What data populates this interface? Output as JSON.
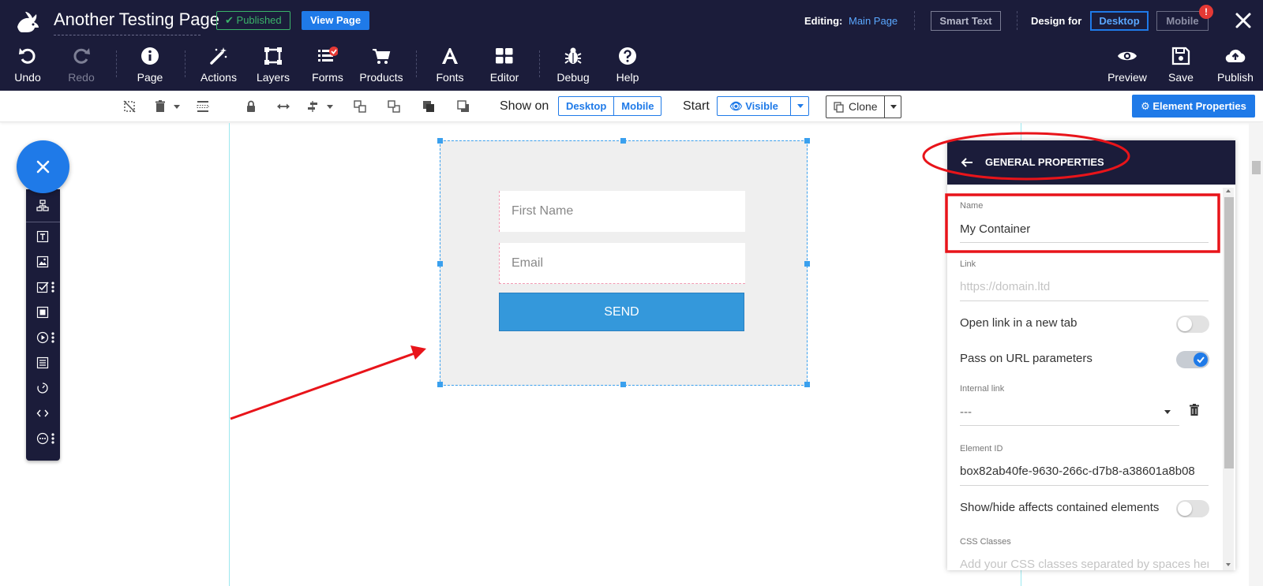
{
  "header": {
    "page_title": "Another Testing Page",
    "published_label": "Published",
    "view_page_label": "View Page",
    "editing_label": "Editing:",
    "editing_value": "Main Page",
    "smart_text_label": "Smart Text",
    "design_for_label": "Design for",
    "design_desktop": "Desktop",
    "design_mobile": "Mobile",
    "alert_count": "!"
  },
  "toolbar": [
    {
      "label": "Undo",
      "icon": "undo-icon"
    },
    {
      "label": "Redo",
      "icon": "redo-icon",
      "disabled": true
    },
    {
      "label": "Page",
      "icon": "info-icon"
    },
    {
      "label": "Actions",
      "icon": "magic-wand-icon"
    },
    {
      "label": "Layers",
      "icon": "layers-icon"
    },
    {
      "label": "Forms",
      "icon": "forms-icon"
    },
    {
      "label": "Products",
      "icon": "cart-icon"
    },
    {
      "label": "Fonts",
      "icon": "font-icon"
    },
    {
      "label": "Editor",
      "icon": "grid-icon"
    },
    {
      "label": "Debug",
      "icon": "bug-icon"
    },
    {
      "label": "Help",
      "icon": "help-icon"
    },
    {
      "label": "Preview",
      "icon": "eye-icon"
    },
    {
      "label": "Save",
      "icon": "floppy-icon"
    },
    {
      "label": "Publish",
      "icon": "cloud-upload-icon"
    }
  ],
  "subbar": {
    "show_on_label": "Show on",
    "show_desktop": "Desktop",
    "show_mobile": "Mobile",
    "start_label": "Start",
    "visible_label": "Visible",
    "clone_label": "Clone",
    "element_properties_label": "Element Properties"
  },
  "form": {
    "first_name_placeholder": "First Name",
    "email_placeholder": "Email",
    "send_label": "SEND"
  },
  "panel": {
    "title": "GENERAL PROPERTIES",
    "name_label": "Name",
    "name_value": "My Container",
    "link_label": "Link",
    "link_placeholder": "https://domain.ltd",
    "open_new_tab_label": "Open link in a new tab",
    "open_new_tab_on": false,
    "pass_url_label": "Pass on URL parameters",
    "pass_url_on": true,
    "internal_link_label": "Internal link",
    "internal_link_value": "---",
    "element_id_label": "Element ID",
    "element_id_value": "box82ab40fe-9630-266c-d7b8-a38601a8b08",
    "show_hide_label": "Show/hide affects contained elements",
    "show_hide_on": false,
    "css_classes_label": "CSS Classes",
    "css_classes_placeholder": "Add your CSS classes separated by spaces here"
  },
  "colors": {
    "navy": "#1b1c3a",
    "accent": "#1f7ae8",
    "published_green": "#3bb46a",
    "send_button": "#3498db",
    "annotation_red": "#e8141a"
  }
}
